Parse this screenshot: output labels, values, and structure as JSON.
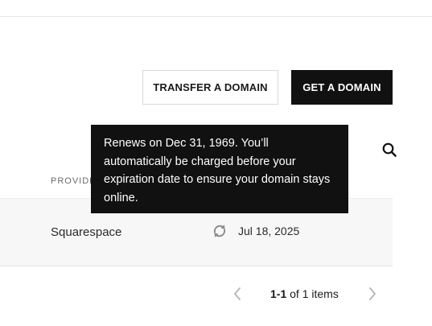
{
  "actions": {
    "transfer_label": "TRANSFER A DOMAIN",
    "get_label": "GET A DOMAIN"
  },
  "table": {
    "provider_header": "PROVIDER",
    "rows": [
      {
        "provider": "Squarespace",
        "renewal_icon": "auto-renew-icon",
        "expiry": "Jul 18, 2025"
      }
    ]
  },
  "tooltip": {
    "text": "Renews on Dec 31, 1969. You’ll automatically be charged before your expiration date to ensure your domain stays online."
  },
  "pagination": {
    "range": "1-1",
    "of_label": "of",
    "total": "1",
    "unit": "items"
  },
  "colors": {
    "primary_button": "#111111",
    "tooltip_bg": "#111111",
    "row_bg": "#f7f7f7"
  },
  "icons": [
    "search-icon",
    "auto-renew-icon",
    "chevron-left-icon",
    "chevron-right-icon"
  ]
}
